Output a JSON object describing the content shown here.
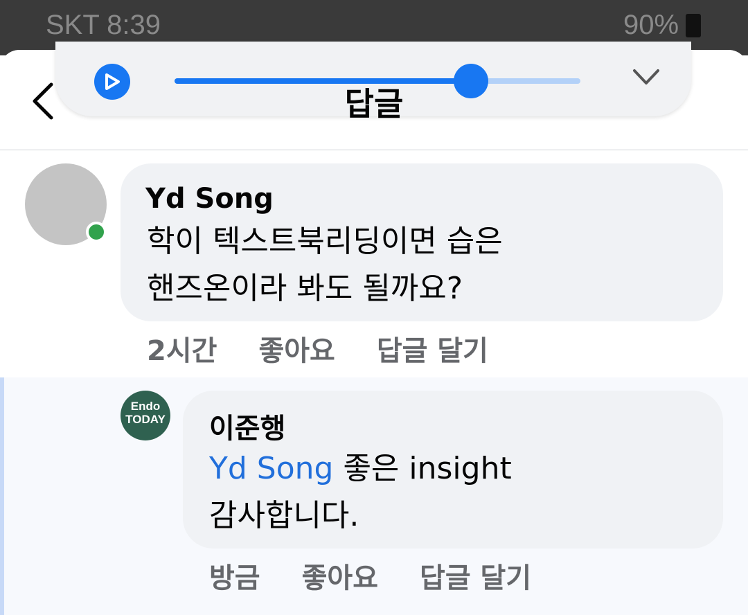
{
  "status_bar": {
    "carrier": "SKT 8:39",
    "battery": "90%"
  },
  "media_player": {
    "progress": 0.73
  },
  "header": {
    "title": "답글",
    "back_icon": "chevron-left-icon"
  },
  "comment": {
    "author": "Yd Song",
    "text_line1": "학이 텍스트북리딩이면 습은",
    "text_line2": "핸즈온이라 봐도 될까요?",
    "time": "2시간",
    "like": "좋아요",
    "reply": "답글 달기",
    "online": true
  },
  "reply": {
    "author": "이준행",
    "avatar_line1": "Endo",
    "avatar_line2": "TODAY",
    "mention": "Yd Song",
    "text_line1_rest": " 좋은 insight",
    "text_line2": "감사합니다.",
    "time": "방금",
    "like": "좋아요",
    "reply": "답글 달기"
  },
  "colors": {
    "accent": "#1877f2",
    "bubble": "#f0f2f5",
    "online": "#31a24c",
    "mention": "#216fdb"
  }
}
